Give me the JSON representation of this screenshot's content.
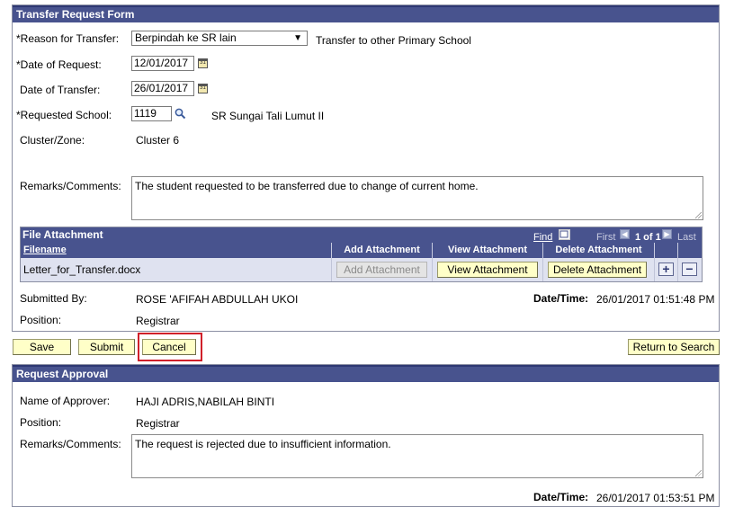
{
  "transfer_form": {
    "title": "Transfer Request Form",
    "reason_label": "*Reason for Transfer:",
    "reason_selected": "Berpindah ke SR lain",
    "reason_description": "Transfer to other Primary School",
    "date_request_label": "*Date of Request:",
    "date_request_value": "12/01/2017",
    "date_transfer_label": "Date of Transfer:",
    "date_transfer_value": "26/01/2017",
    "requested_school_label": "*Requested School:",
    "requested_school_value": "1119",
    "requested_school_name": "SR Sungai Tali Lumut II",
    "cluster_label": "Cluster/Zone:",
    "cluster_value": "Cluster 6",
    "remarks_label": "Remarks/Comments:",
    "remarks_value": "The student requested to be transferred due to change of current home.",
    "submitted_by_label": "Submitted By:",
    "submitted_by_value": "ROSE 'AFIFAH ABDULLAH UKOI",
    "datetime_label": "Date/Time:",
    "datetime_value": "26/01/2017 01:51:48 PM",
    "position_label": "Position:",
    "position_value": "Registrar"
  },
  "file_attachment": {
    "title": "File Attachment",
    "find_label": "Find",
    "first_label": "First",
    "count_label": "1 of 1",
    "last_label": "Last",
    "columns": [
      "Filename",
      "Add Attachment",
      "View Attachment",
      "Delete Attachment"
    ],
    "rows": [
      {
        "filename": "Letter_for_Transfer.docx",
        "add_label": "Add Attachment",
        "view_label": "View Attachment",
        "delete_label": "Delete Attachment"
      }
    ]
  },
  "actions": {
    "save": "Save",
    "submit": "Submit",
    "cancel": "Cancel",
    "return_to_search": "Return to Search"
  },
  "request_approval": {
    "title": "Request Approval",
    "approver_label": "Name of Approver:",
    "approver_value": "HAJI ADRIS,NABILAH BINTI",
    "position_label": "Position:",
    "position_value": "Registrar",
    "remarks_label": "Remarks/Comments:",
    "remarks_value": "The request is rejected due to insufficient information.",
    "datetime_label": "Date/Time:",
    "datetime_value": "26/01/2017 01:53:51 PM"
  },
  "colors": {
    "header_bg": "#48538e",
    "button_bg": "#ffffc8",
    "highlight_border": "#d0202a"
  }
}
